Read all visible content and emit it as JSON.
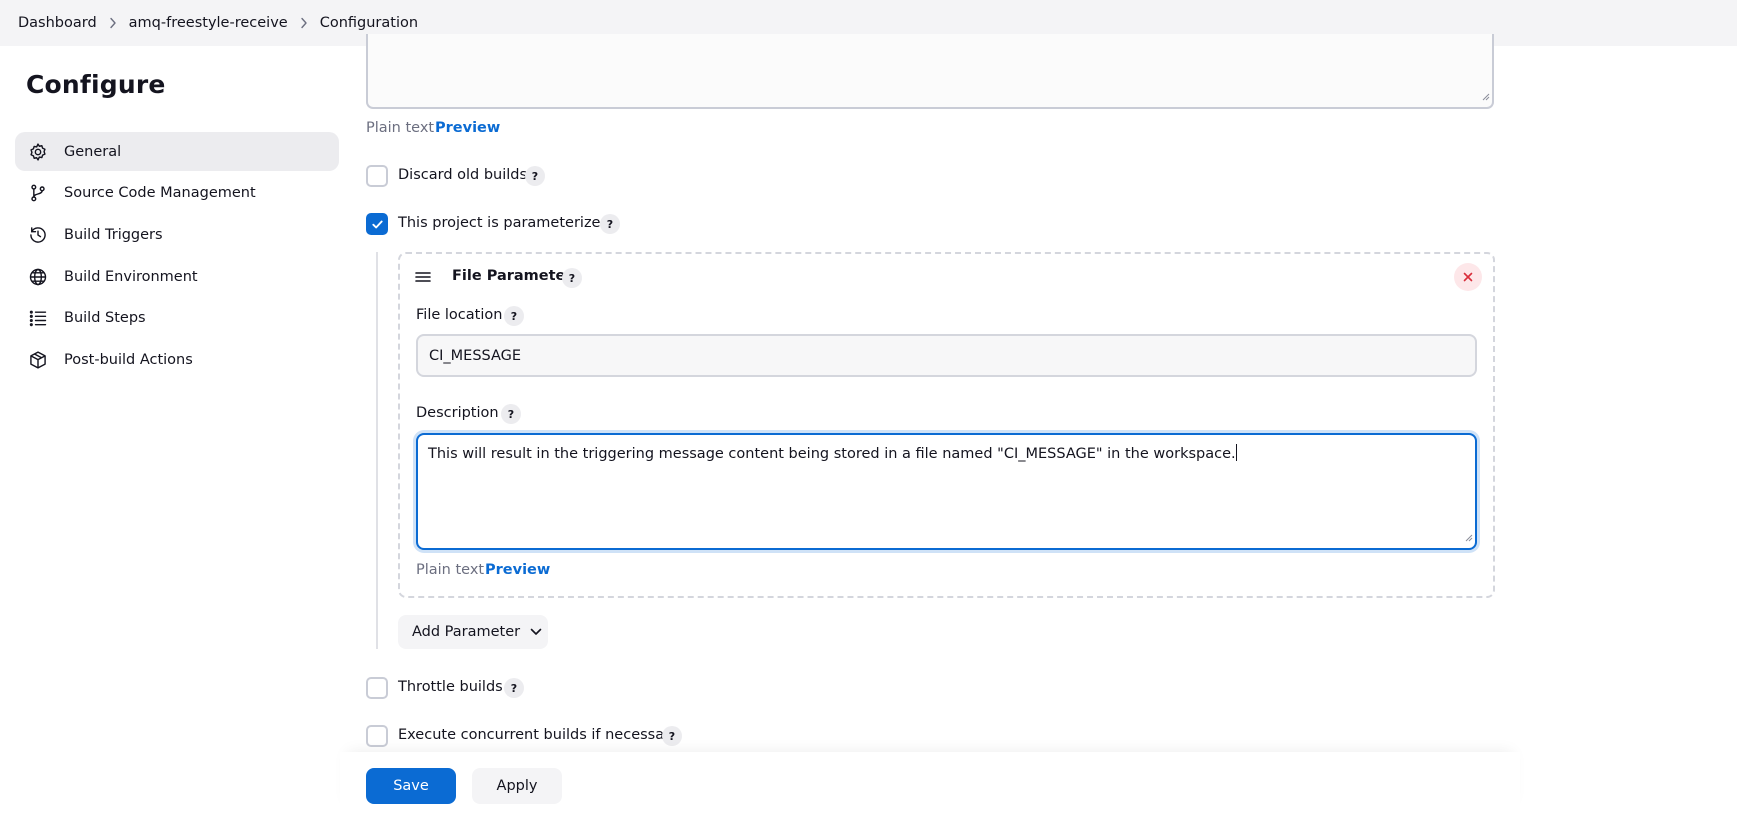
{
  "breadcrumb": {
    "items": [
      "Dashboard",
      "amq-freestyle-receive",
      "Configuration"
    ]
  },
  "sidebar": {
    "title": "Configure",
    "items": [
      {
        "label": "General",
        "icon": "gear-icon",
        "active": true
      },
      {
        "label": "Source Code Management",
        "icon": "git-branch-icon"
      },
      {
        "label": "Build Triggers",
        "icon": "clock-icon"
      },
      {
        "label": "Build Environment",
        "icon": "globe-icon"
      },
      {
        "label": "Build Steps",
        "icon": "list-icon"
      },
      {
        "label": "Post-build Actions",
        "icon": "cube-icon"
      }
    ]
  },
  "main": {
    "project_description": {
      "plain_text": "Plain text",
      "preview": "Preview"
    },
    "discard_old_builds": {
      "label": "Discard old builds",
      "checked": false,
      "help": "?"
    },
    "parameterized": {
      "label": "This project is parameterized",
      "checked": true,
      "help": "?"
    },
    "file_parameter": {
      "title": "File Parameter",
      "help": "?",
      "file_location_label": "File location",
      "file_location_help": "?",
      "file_location_value": "CI_MESSAGE",
      "description_label": "Description",
      "description_help": "?",
      "description_value": "This will result in the triggering message content being stored in a file named \"CI_MESSAGE\" in the workspace.",
      "plain_text": "Plain text",
      "preview": "Preview"
    },
    "add_parameter": "Add Parameter",
    "throttle_builds": {
      "label": "Throttle builds",
      "checked": false,
      "help": "?"
    },
    "concurrent_builds": {
      "label": "Execute concurrent builds if necessary",
      "checked": false,
      "help": "?"
    }
  },
  "footer": {
    "save": "Save",
    "apply": "Apply"
  },
  "colors": {
    "accent": "#0b6bd3",
    "close_bg": "#fde7e9",
    "close_icon": "#d92e3b"
  }
}
